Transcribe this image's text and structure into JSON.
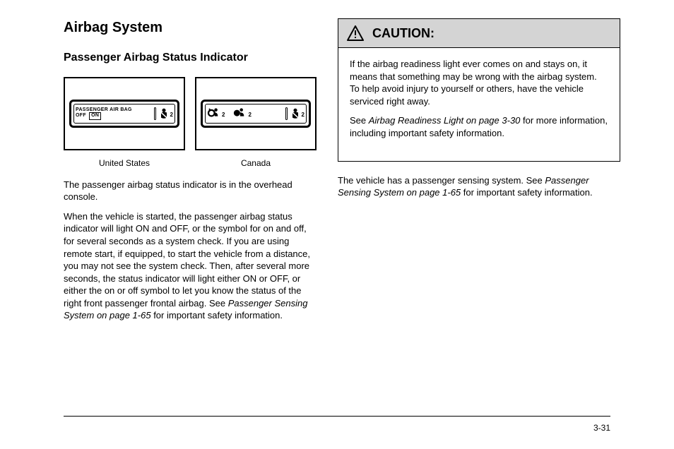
{
  "section_title": "Airbag System",
  "subsection_title": "Passenger Airbag Status Indicator",
  "caption_us": "United States",
  "caption_ca": "Canada",
  "para_left_1": "The passenger airbag status indicator is in the overhead console.",
  "para_left_2_a": "When the vehicle is started, the passenger airbag status indicator will light ON and OFF, or the symbol for on and off, for several seconds as a system check. If you are using remote start, if equipped, to start the vehicle from a distance, you may not see the system check. Then, after several more seconds, the status indicator will light either ON or OFF, or either the on or off symbol to let you know the status of the right front passenger frontal airbag. See ",
  "para_left_2_link": "Passenger Sensing System on page 1-65",
  "para_left_2_b": " for important safety information.",
  "caution": {
    "title": "CAUTION:",
    "p1": "If the airbag readiness light ever comes on and stays on, it means that something may be wrong with the airbag system. To help avoid injury to yourself or others, have the vehicle serviced right away.",
    "p2_a": "See ",
    "p2_link": "Airbag Readiness Light on page 3-30",
    "p2_b": " for more information, including important safety information."
  },
  "right_para_a": "The vehicle has a passenger sensing system. See ",
  "right_para_link": "Passenger Sensing System on page 1-65",
  "right_para_b": " for important safety information.",
  "page_number": "3-31",
  "indicator_us": {
    "line1": "PASSENGER AIR BAG",
    "line2": "OFF",
    "on": "ON",
    "two": "2"
  },
  "indicator_ca": {
    "two": "2"
  }
}
